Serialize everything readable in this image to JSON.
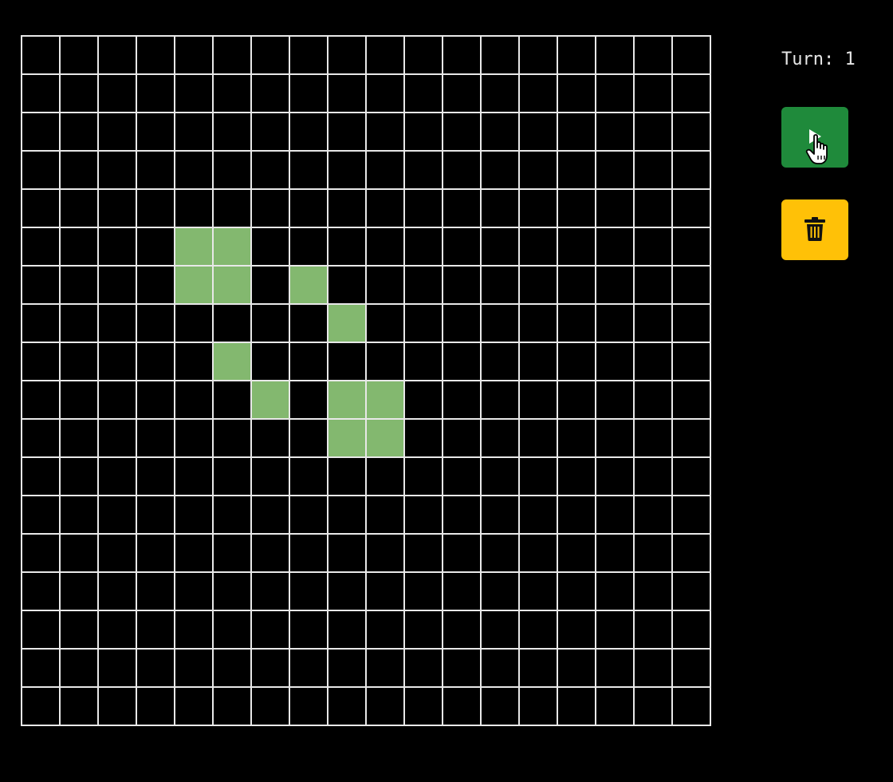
{
  "board": {
    "rows": 18,
    "cols": 18,
    "alive_cells": [
      [
        5,
        4
      ],
      [
        5,
        5
      ],
      [
        6,
        4
      ],
      [
        6,
        5
      ],
      [
        6,
        7
      ],
      [
        7,
        8
      ],
      [
        8,
        5
      ],
      [
        9,
        6
      ],
      [
        9,
        8
      ],
      [
        9,
        9
      ],
      [
        10,
        8
      ],
      [
        10,
        9
      ]
    ],
    "colors": {
      "alive": "#83b86f",
      "dead": "#000000",
      "grid_line": "#e8e8e8"
    }
  },
  "status": {
    "turn_label": "Turn: 1"
  },
  "controls": {
    "play": {
      "icon": "play-icon",
      "color": "#1f8a3b"
    },
    "clear": {
      "icon": "trash-icon",
      "color": "#ffc107"
    }
  }
}
